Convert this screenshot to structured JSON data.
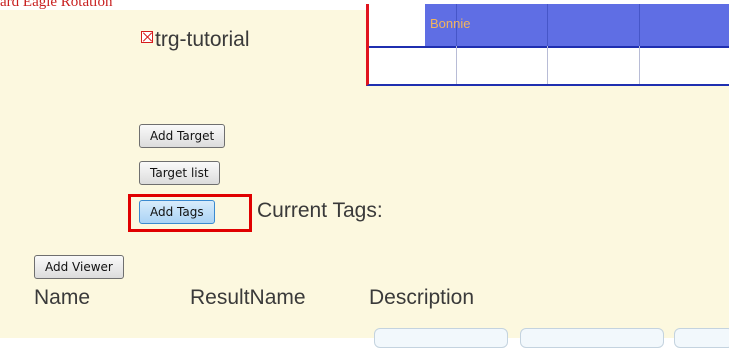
{
  "top_caption": "ard Eagle Rotation",
  "tutorial": {
    "title": "trg-tutorial"
  },
  "timeline": {
    "first_name": "Bonnie"
  },
  "buttons": {
    "add_target": "Add Target",
    "target_list": "Target list",
    "add_tags": "Add Tags",
    "add_viewer": "Add Viewer"
  },
  "tags": {
    "label": "Current Tags:"
  },
  "table": {
    "headers": [
      "Name",
      "ResultName",
      "Description"
    ]
  },
  "colors": {
    "panel_bg": "#fcf8df",
    "grid_header": "#5f6ee4",
    "grid_border": "#1f2fb0",
    "highlight": "#e00000",
    "button_active": "#aad3f5"
  }
}
